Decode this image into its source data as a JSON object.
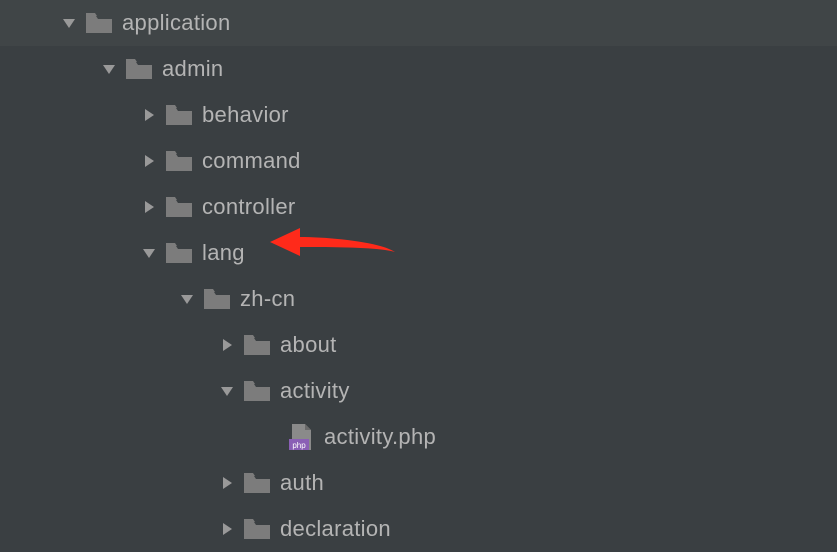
{
  "tree": {
    "root": "application",
    "admin": "admin",
    "behavior": "behavior",
    "command": "command",
    "controller": "controller",
    "lang": "lang",
    "zhcn": "zh-cn",
    "about": "about",
    "activity": "activity",
    "activity_php": "activity.php",
    "auth": "auth",
    "declaration": "declaration"
  },
  "colors": {
    "folder": "#7c7c7c",
    "expand": "#999999",
    "text": "#b4b4b4",
    "php_badge": "#9b5fb5",
    "arrow": "#ff2a1a"
  }
}
